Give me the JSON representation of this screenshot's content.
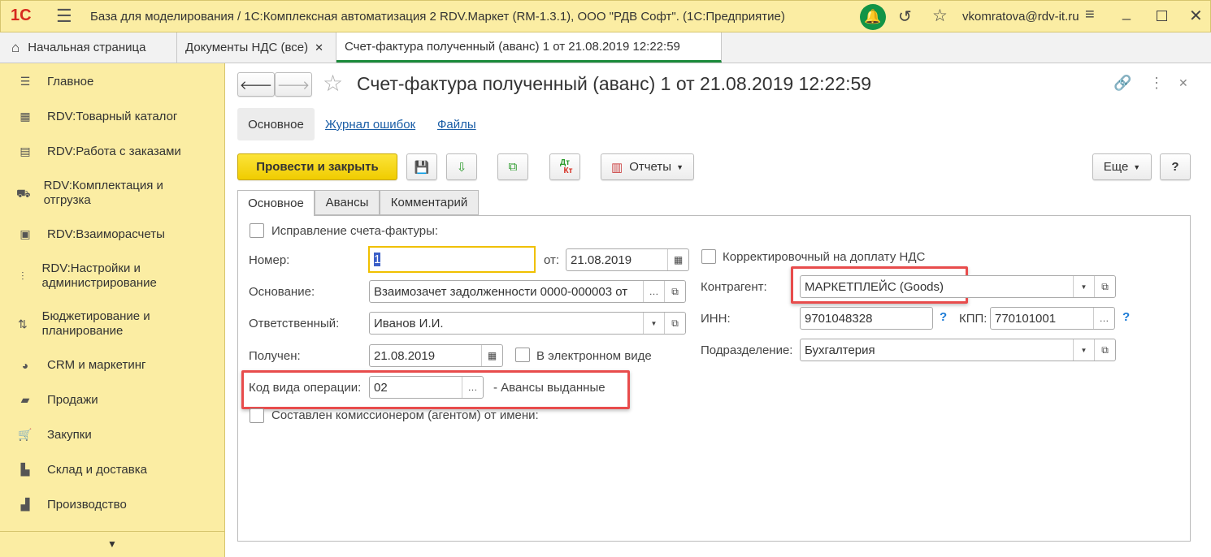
{
  "titlebar": {
    "logo": "1С",
    "title": "База для моделирования / 1С:Комплексная автоматизация 2 RDV.Маркет (RM-1.3.1), ООО \"РДВ Софт\".  (1С:Предприятие)",
    "user": "vkomratova@rdv-it.ru"
  },
  "tabs": [
    {
      "label": "Начальная страница"
    },
    {
      "label": "Документы НДС (все)"
    },
    {
      "label": "Счет-фактура полученный (аванс) 1 от 21.08.2019 12:22:59"
    }
  ],
  "sidebar": {
    "items": [
      {
        "label": "Главное"
      },
      {
        "label": "RDV:Товарный каталог"
      },
      {
        "label": "RDV:Работа с заказами"
      },
      {
        "label": "RDV:Комплектация и отгрузка"
      },
      {
        "label": "RDV:Взаиморасчеты"
      },
      {
        "label": "RDV:Настройки и администрирование"
      },
      {
        "label": "Бюджетирование и планирование"
      },
      {
        "label": "CRM и маркетинг"
      },
      {
        "label": "Продажи"
      },
      {
        "label": "Закупки"
      },
      {
        "label": "Склад и доставка"
      },
      {
        "label": "Производство"
      }
    ]
  },
  "doc": {
    "title": "Счет-фактура полученный (аванс) 1 от 21.08.2019 12:22:59",
    "nav": {
      "main": "Основное",
      "errors": "Журнал ошибок",
      "files": "Файлы"
    },
    "toolbar": {
      "post_close": "Провести и закрыть",
      "reports": "Отчеты",
      "more": "Еще",
      "help": "?",
      "dtkt_top": "Дт",
      "dtkt_bottom": "Кт"
    },
    "formtabs": [
      "Основное",
      "Авансы",
      "Комментарий"
    ],
    "fields": {
      "correction": "Исправление счета-фактуры:",
      "number_label": "Номер:",
      "number": "1",
      "from_label": "от:",
      "date": "21.08.2019",
      "basis_label": "Основание:",
      "basis": "Взаимозачет задолженности 0000-000003 от",
      "resp_label": "Ответственный:",
      "resp": "Иванов И.И.",
      "received_label": "Получен:",
      "received": "21.08.2019",
      "electronic": "В электронном виде",
      "opcode_label": "Код вида операции:",
      "opcode": "02",
      "opcode_desc": "- Авансы выданные",
      "agent": "Составлен комиссионером (агентом) от имени:",
      "corrective": "Корректировочный на доплату НДС",
      "counterparty_label": "Контрагент:",
      "counterparty": "МАРКЕТПЛЕЙС (Goods)",
      "inn_label": "ИНН:",
      "inn": "9701048328",
      "kpp_label": "КПП:",
      "kpp": "770101001",
      "dept_label": "Подразделение:",
      "dept": "Бухгалтерия",
      "q": "?"
    }
  }
}
